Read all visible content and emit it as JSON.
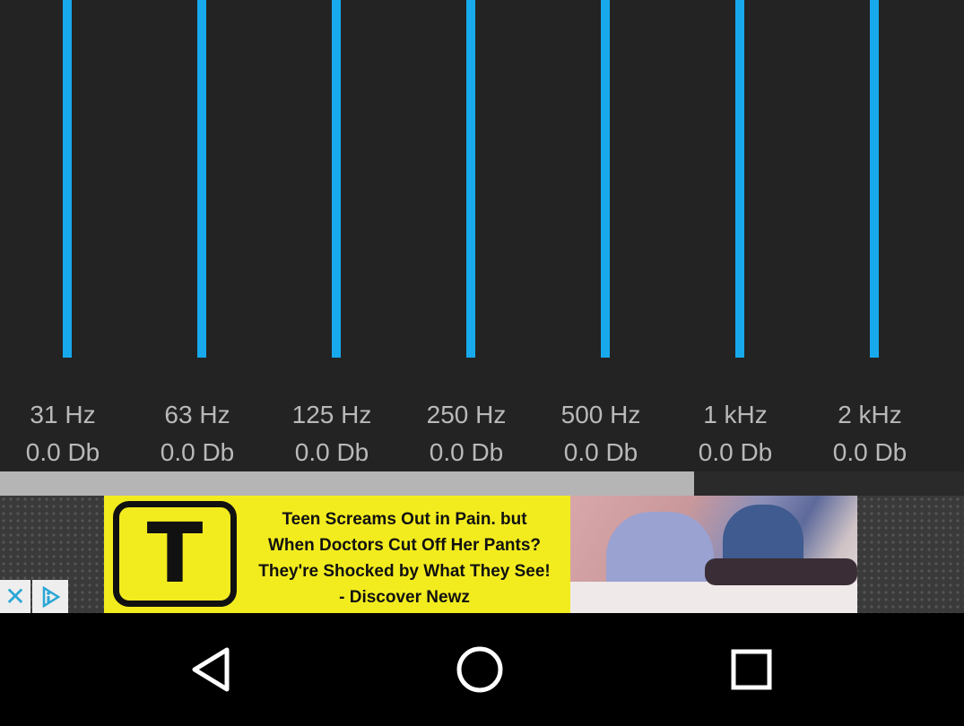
{
  "equalizer": {
    "bands": [
      {
        "freq": "31 Hz",
        "gain": "0.0 Db"
      },
      {
        "freq": "63 Hz",
        "gain": "0.0 Db"
      },
      {
        "freq": "125 Hz",
        "gain": "0.0 Db"
      },
      {
        "freq": "250 Hz",
        "gain": "0.0 Db"
      },
      {
        "freq": "500 Hz",
        "gain": "0.0 Db"
      },
      {
        "freq": "1 kHz",
        "gain": "0.0 Db"
      },
      {
        "freq": "2 kHz",
        "gain": "0.0 Db"
      }
    ],
    "slider_color": "#17a9ec"
  },
  "scrollbar": {
    "visible_fraction": 0.72
  },
  "ad": {
    "logo_letter": "T",
    "text_lines": [
      "Teen Screams Out in Pain. but",
      "When Doctors Cut Off Her Pants?",
      "They're Shocked by What They See!",
      "- Discover Newz"
    ],
    "background_color": "#f2ec1f",
    "close_icon": "close-icon",
    "choices_icon": "adchoices-icon"
  },
  "navigation": {
    "back_icon": "back-triangle-icon",
    "home_icon": "home-circle-icon",
    "recents_icon": "recents-square-icon"
  }
}
